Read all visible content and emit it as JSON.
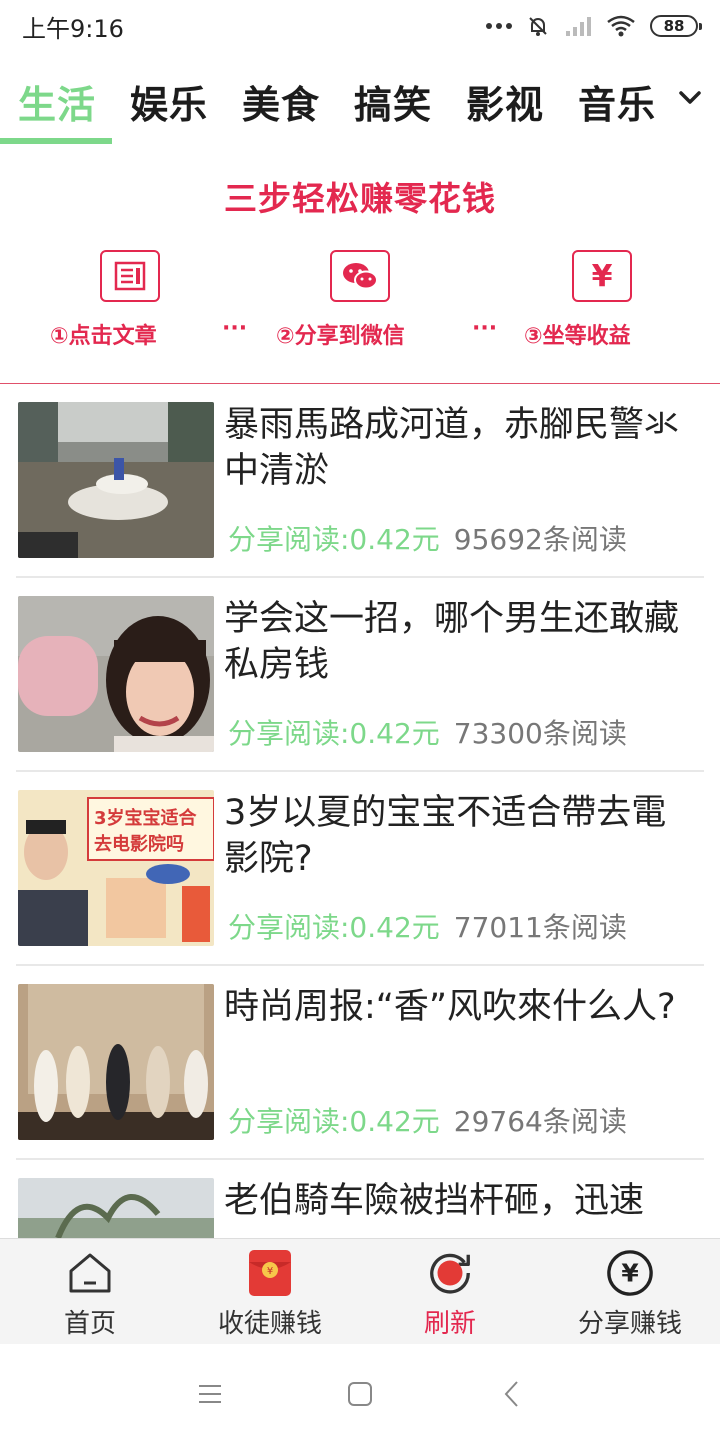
{
  "status_bar": {
    "time": "上午9:16",
    "battery": "88"
  },
  "tabs": [
    {
      "label": "生活",
      "active": true
    },
    {
      "label": "娱乐",
      "active": false
    },
    {
      "label": "美食",
      "active": false
    },
    {
      "label": "搞笑",
      "active": false
    },
    {
      "label": "影视",
      "active": false
    },
    {
      "label": "音乐",
      "active": false
    }
  ],
  "promo": {
    "title": "三步轻松赚零花钱",
    "steps": [
      {
        "icon": "document-icon",
        "label": "①点击文章"
      },
      {
        "icon": "wechat-icon",
        "label": "②分享到微信"
      },
      {
        "icon": "yuan-icon",
        "label": "③坐等收益"
      }
    ],
    "separator": "···"
  },
  "articles": [
    {
      "title": "暴雨馬路成河道，赤腳民警氺中清淤",
      "reward": "分享阅读:0.42元",
      "reads": "95692条阅读"
    },
    {
      "title": "学会这一招，哪个男生还敢藏私房钱",
      "reward": "分享阅读:0.42元",
      "reads": "73300条阅读"
    },
    {
      "title": "3岁以夏的宝宝不适合帶去電影院?",
      "reward": "分享阅读:0.42元",
      "reads": "77011条阅读"
    },
    {
      "title": "時尚周报:“香”风吹來什么人?",
      "reward": "分享阅读:0.42元",
      "reads": "29764条阅读"
    },
    {
      "title": "老伯騎车險被挡杆砸，迅速",
      "reward": "",
      "reads": ""
    }
  ],
  "thumb_texts": {
    "poster_line1": "3岁宝宝适合",
    "poster_line2": "去电影院吗"
  },
  "bottom_nav": [
    {
      "label": "首页",
      "icon": "home-icon"
    },
    {
      "label": "收徒赚钱",
      "icon": "red-envelope-icon"
    },
    {
      "label": "刷新",
      "icon": "refresh-icon",
      "highlight": true
    },
    {
      "label": "分享赚钱",
      "icon": "yuan-circle-icon"
    }
  ],
  "colors": {
    "accent_green": "#7dd88a",
    "promo_red": "#e3284f"
  }
}
